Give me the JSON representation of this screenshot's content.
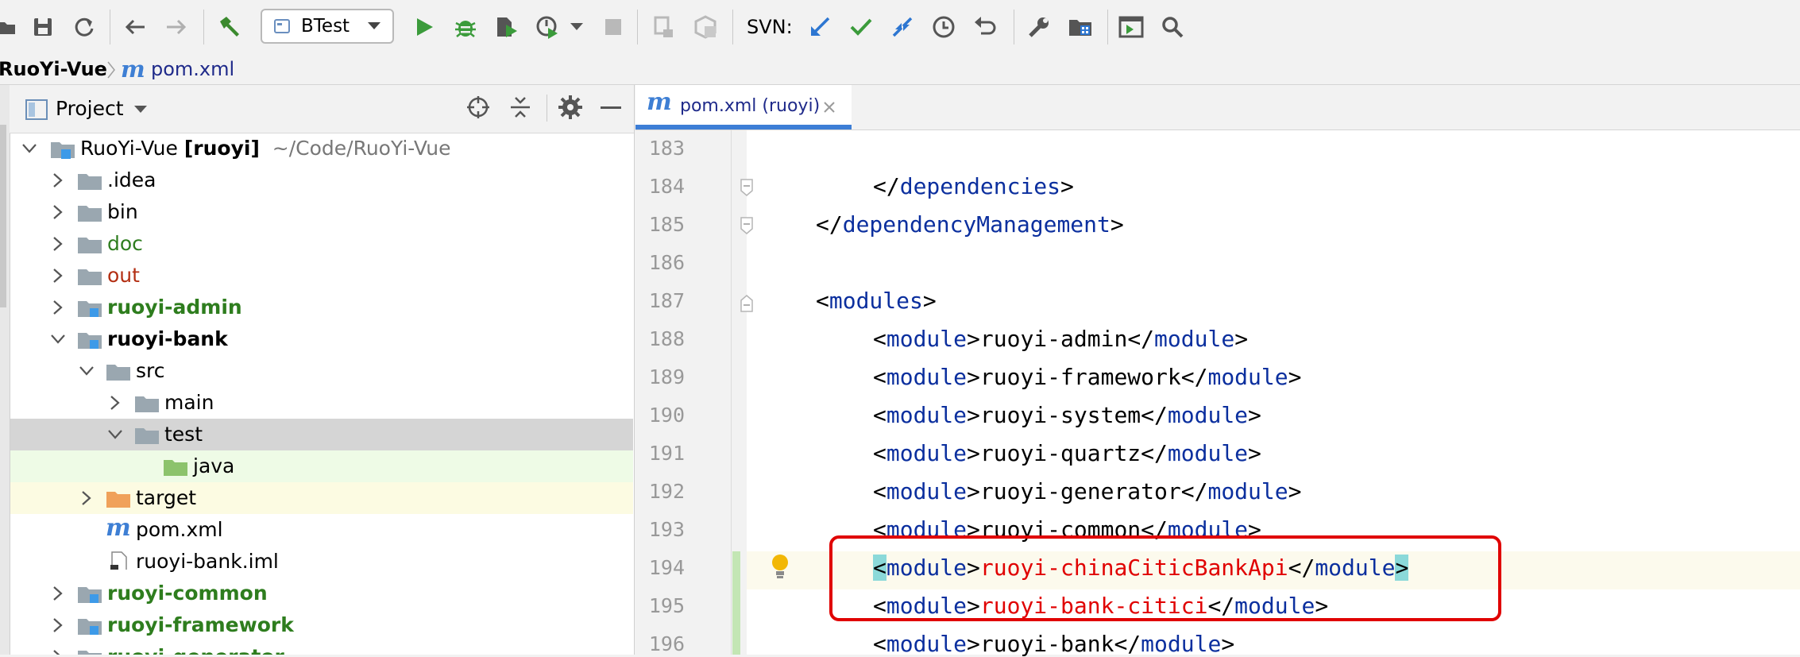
{
  "toolbar": {
    "run_config": "BTest",
    "svn_label": "SVN:"
  },
  "breadcrumb": {
    "project": "RuoYi-Vue",
    "file": "pom.xml"
  },
  "project_panel": {
    "title": "Project",
    "tree": [
      {
        "label": "RuoYi-Vue",
        "module": "[ruoyi]",
        "path": "~/Code/RuoYi-Vue"
      },
      {
        "label": ".idea"
      },
      {
        "label": "bin"
      },
      {
        "label": "doc"
      },
      {
        "label": "out"
      },
      {
        "label": "ruoyi-admin"
      },
      {
        "label": "ruoyi-bank"
      },
      {
        "label": "src"
      },
      {
        "label": "main"
      },
      {
        "label": "test"
      },
      {
        "label": "java"
      },
      {
        "label": "target"
      },
      {
        "label": "pom.xml"
      },
      {
        "label": "ruoyi-bank.iml"
      },
      {
        "label": "ruoyi-common"
      },
      {
        "label": "ruoyi-framework"
      },
      {
        "label": "ruoyi-generator"
      }
    ]
  },
  "editor": {
    "tab": "pom.xml (ruoyi)",
    "lines": [
      {
        "num": "183",
        "a": "",
        "b": "",
        "c": ""
      },
      {
        "num": "184",
        "a": "</",
        "b": "dependencies",
        "c": ">"
      },
      {
        "num": "185",
        "a": "</",
        "b": "dependencyManagement",
        "c": ">"
      },
      {
        "num": "186",
        "a": "",
        "b": "",
        "c": ""
      },
      {
        "num": "187",
        "a": "<",
        "b": "modules",
        "c": ">"
      },
      {
        "num": "188",
        "value": "ruoyi-admin"
      },
      {
        "num": "189",
        "value": "ruoyi-framework"
      },
      {
        "num": "190",
        "value": "ruoyi-system"
      },
      {
        "num": "191",
        "value": "ruoyi-quartz"
      },
      {
        "num": "192",
        "value": "ruoyi-generator"
      },
      {
        "num": "193",
        "value": "ruoyi-common"
      },
      {
        "num": "194",
        "value": "ruoyi-chinaCiticBankApi"
      },
      {
        "num": "195",
        "value": "ruoyi-bank-citici"
      },
      {
        "num": "196",
        "value": "ruoyi-bank"
      }
    ],
    "tag_module": "module"
  },
  "colors": {
    "highlight_box": "#e00000",
    "tag": "#0b2f9e",
    "green_module": "#2e7d1e"
  }
}
